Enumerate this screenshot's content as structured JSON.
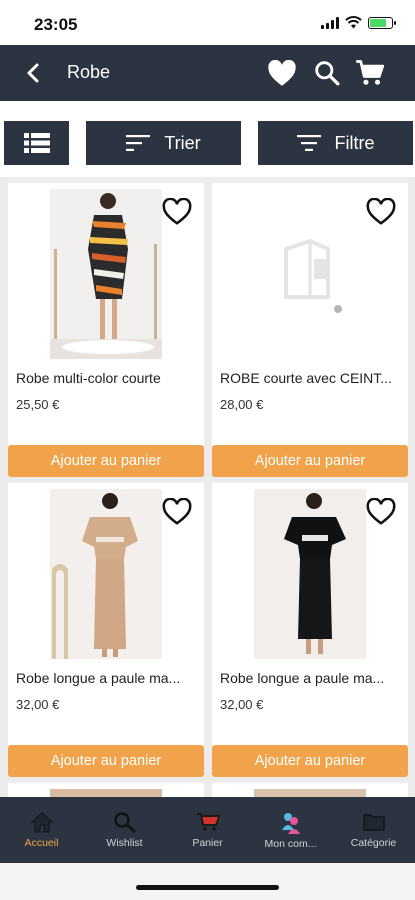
{
  "status": {
    "time": "23:05"
  },
  "header": {
    "title": "Robe",
    "back_icon": "‹"
  },
  "filters": {
    "sort_label": "Trier",
    "filter_label": "Filtre"
  },
  "products": [
    {
      "name": "Robe multi-color  courte",
      "price": "25,50 €",
      "add_label": "Ajouter au panier"
    },
    {
      "name": "ROBE courte avec CEINT...",
      "price": "28,00 €",
      "add_label": "Ajouter au panier"
    },
    {
      "name": "Robe longue  a paule ma...",
      "price": "32,00 €",
      "add_label": "Ajouter au panier"
    },
    {
      "name": "Robe longue  a paule ma...",
      "price": "32,00 €",
      "add_label": "Ajouter au panier"
    }
  ],
  "nav": {
    "items": [
      {
        "label": "Accueil",
        "icon": "home-icon",
        "active": true
      },
      {
        "label": "Wishlist",
        "icon": "search-icon",
        "active": false
      },
      {
        "label": "Panier",
        "icon": "cart-icon",
        "active": false
      },
      {
        "label": "Mon com...",
        "icon": "account-icon",
        "active": false
      },
      {
        "label": "Catégorie",
        "icon": "folder-icon",
        "active": false
      }
    ]
  },
  "colors": {
    "header_bg": "#2b3440",
    "accent": "#f0a34a",
    "battery": "#4cd964"
  }
}
